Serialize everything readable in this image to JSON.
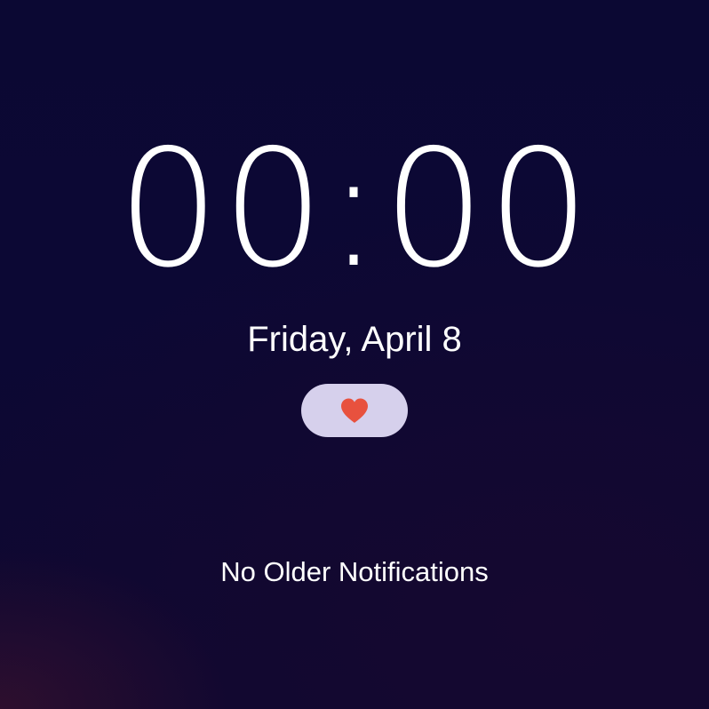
{
  "lock_screen": {
    "time": "00:00",
    "date": "Friday, April 8",
    "widget": {
      "icon": "heart-icon",
      "icon_color": "#e8513e",
      "background_color": "#d6d0ec"
    },
    "notifications_label": "No Older Notifications"
  },
  "colors": {
    "background": "#0b0833",
    "text": "#ffffff"
  }
}
